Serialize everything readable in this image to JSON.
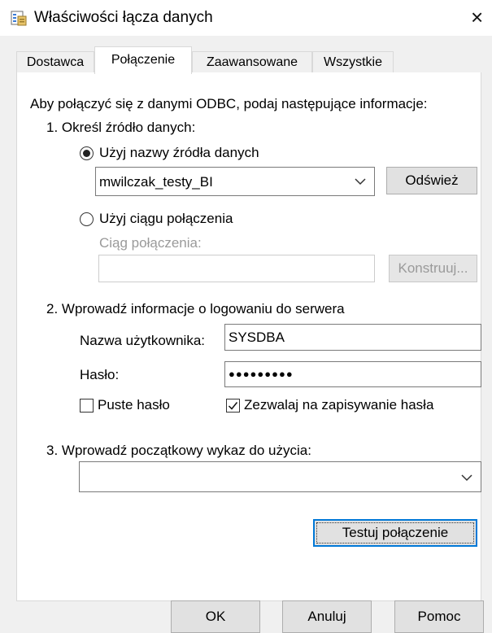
{
  "window": {
    "title": "Właściwości łącza danych",
    "close_glyph": "×"
  },
  "tabs": [
    {
      "label": "Dostawca",
      "active": false
    },
    {
      "label": "Połączenie",
      "active": true
    },
    {
      "label": "Zaawansowane",
      "active": false
    },
    {
      "label": "Wszystkie",
      "active": false
    }
  ],
  "connection": {
    "intro": "Aby połączyć się z danymi ODBC, podaj następujące informacje:",
    "step1": "1. Określ źródło danych:",
    "use_dsn_label": "Użyj nazwy źródła danych",
    "use_dsn_selected": true,
    "dsn_value": "mwilczak_testy_BI",
    "refresh_label": "Odśwież",
    "use_conn_string_label": "Użyj ciągu połączenia",
    "conn_string_caption": "Ciąg połączenia:",
    "conn_string_value": "",
    "build_label": "Konstruuj...",
    "step2": "2. Wprowadź informacje o logowaniu do serwera",
    "username_label": "Nazwa użytkownika:",
    "username_value": "SYSDBA",
    "password_label": "Hasło:",
    "password_mask": "●●●●●●●●●",
    "blank_password_label": "Puste hasło",
    "blank_password_checked": false,
    "allow_save_label": "Zezwalaj na zapisywanie hasła",
    "allow_save_checked": true,
    "step3": "3. Wprowadź początkowy wykaz do użycia:",
    "catalog_value": "",
    "test_label": "Testuj połączenie"
  },
  "footer": {
    "ok_label": "OK",
    "cancel_label": "Anuluj",
    "help_label": "Pomoc"
  }
}
